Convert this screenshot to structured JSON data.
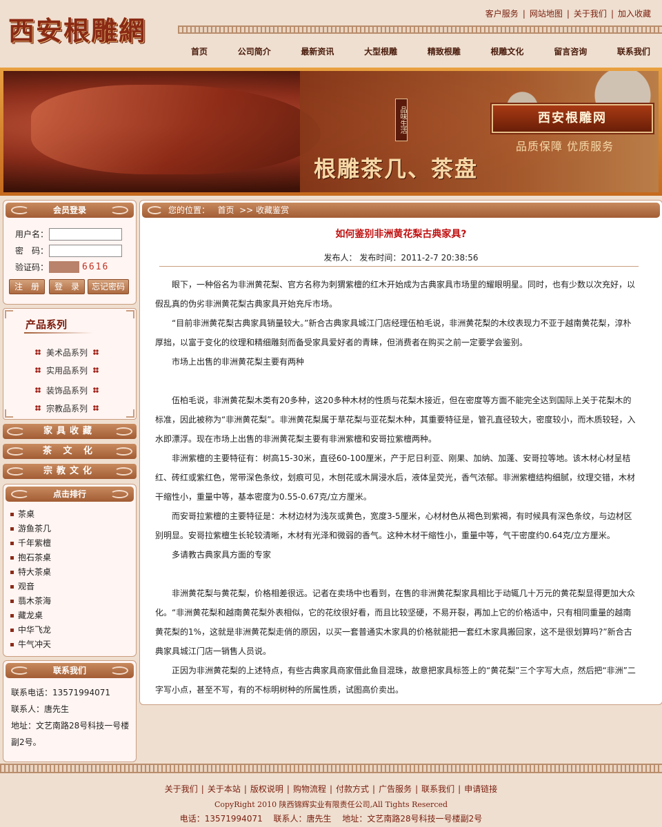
{
  "site": {
    "logo": "西安根雕網",
    "top_links": [
      "客户服务",
      "网站地图",
      "关于我们",
      "加入收藏"
    ],
    "nav": [
      "首页",
      "公司简介",
      "最新资讯",
      "大型根雕",
      "精致根雕",
      "根雕文化",
      "留言咨询",
      "联系我们"
    ]
  },
  "banner": {
    "tag": "品味生活",
    "brand": "西安根雕网",
    "slogan": "品质保障   优质服务",
    "headline": "根雕茶几、茶盘"
  },
  "login": {
    "title": "会员登录",
    "username_label": "用户名：",
    "password_label": "密　码：",
    "captcha_label": "验证码：",
    "captcha_code": "6616",
    "register": "注　册",
    "login": "登　录",
    "forgot": "忘记密码"
  },
  "products": {
    "title": "产品系列",
    "items": [
      "美术品系列",
      "实用品系列",
      "装饰品系列",
      "宗教品系列"
    ]
  },
  "bars": [
    "家具收藏",
    "茶 文 化",
    "宗教文化"
  ],
  "rank": {
    "title": "点击排行",
    "items": [
      "茶桌",
      "游鱼茶几",
      "千年紫檀",
      "抱石茶桌",
      "特大茶桌",
      "观音",
      "翡木茶海",
      "藏龙桌",
      "中华飞龙",
      "牛气冲天"
    ]
  },
  "contact": {
    "title": "联系我们",
    "phone": "联系电话：13571994071",
    "person": "联系人：唐先生",
    "address": "地址：文艺南路28号科技一号楼副2号。"
  },
  "breadcrumb": {
    "label": "您的位置：",
    "home": "首页",
    "sep": ">>",
    "current": "收藏鉴赏"
  },
  "article": {
    "title": "如何鉴别非洲黄花梨古典家具?",
    "meta": "发布人：  发布时间：2011-2-7  20:38:56",
    "paragraphs": [
      "眼下，一种俗名为非洲黄花梨、官方名称为刺猬紫檀的红木开始成为古典家具市场里的耀眼明星。同时，也有少数以次充好，以假乱真的伪劣非洲黄花梨古典家具开始充斥市场。",
      "“目前非洲黄花梨古典家具销量较大。”新合古典家具城江门店经理伍柏毛说，非洲黄花梨的木纹表现力不亚于越南黄花梨，淳朴厚拙，以富于变化的纹理和精细雕刻而备受家具爱好者的青睐，但消费者在购买之前一定要学会鉴别。",
      "市场上出售的非洲黄花梨主要有两种",
      "",
      "伍柏毛说，非洲黄花梨木类有20多种，这20多种木材的性质与花梨木接近，但在密度等方面不能完全达到国际上关于花梨木的标准，因此被称为“非洲黄花梨”。非洲黄花梨属于草花梨与亚花梨木种，其重要特征是，管孔直径较大，密度较小，而木质较轻，入水即漂浮。现在市场上出售的非洲黄花梨主要有非洲紫檀和安哥拉紫檀两种。",
      "非洲紫檀的主要特征有：树高15-30米，直径60-100厘米，产于尼日利亚、刚果、加纳、加蓬、安哥拉等地。该木材心材呈桔红、砖红或紫红色，常带深色条纹，划痕可见，木刨花或木屑浸水后，液体呈荧光，香气浓郁。非洲紫檀结构细腻，纹理交错，木材干缩性小，重量中等，基本密度为0.55-0.67克/立方厘米。",
      " 而安哥拉紫檀的主要特征是：木材边材为浅灰或黄色，宽度3-5厘米，心材材色从褐色到紫褐，有时候具有深色条纹，与边材区别明显。安哥拉紫檀生长轮较清晰，木材有光泽和微弱的香气。这种木材干缩性小，重量中等，气干密度约0.64克/立方厘米。",
      "多请教古典家具方面的专家",
      "",
      "非洲黄花梨与黄花梨，价格相差很远。记者在卖场中也看到，在售的非洲黄花梨家具相比于动辄几十万元的黄花梨显得更加大众化。“非洲黄花梨和越南黄花梨外表相似，它的花纹很好看，而且比较坚硬，不易开裂，再加上它的价格适中，只有相同重量的越南黄花梨的1%，这就是非洲黄花梨走俏的原因，以买一套普通实木家具的价格就能把一套红木家具搬回家，这不是很划算吗?”新合古典家具城江门店一销售人员说。",
      "正因为非洲黄花梨的上述特点，有些古典家具商家借此鱼目混珠，故意把家具标签上的“黄花梨”三个字写大点，然后把“非洲”二字写小点，甚至不写，有的不标明树种的所属性质，试图高价卖出。"
    ]
  },
  "footer": {
    "links": [
      "关于我们",
      "关于本站",
      "版权说明",
      "购物流程",
      "付款方式",
      "广告服务",
      "联系我们",
      "申请链接"
    ],
    "copyright": "CopyRight 2010 陕西锦辉实业有限责任公司,All Tights Reserced",
    "info": "电话：13571994071　  联系人：唐先生　  地址：文艺南路28号科技一号楼副2号"
  }
}
